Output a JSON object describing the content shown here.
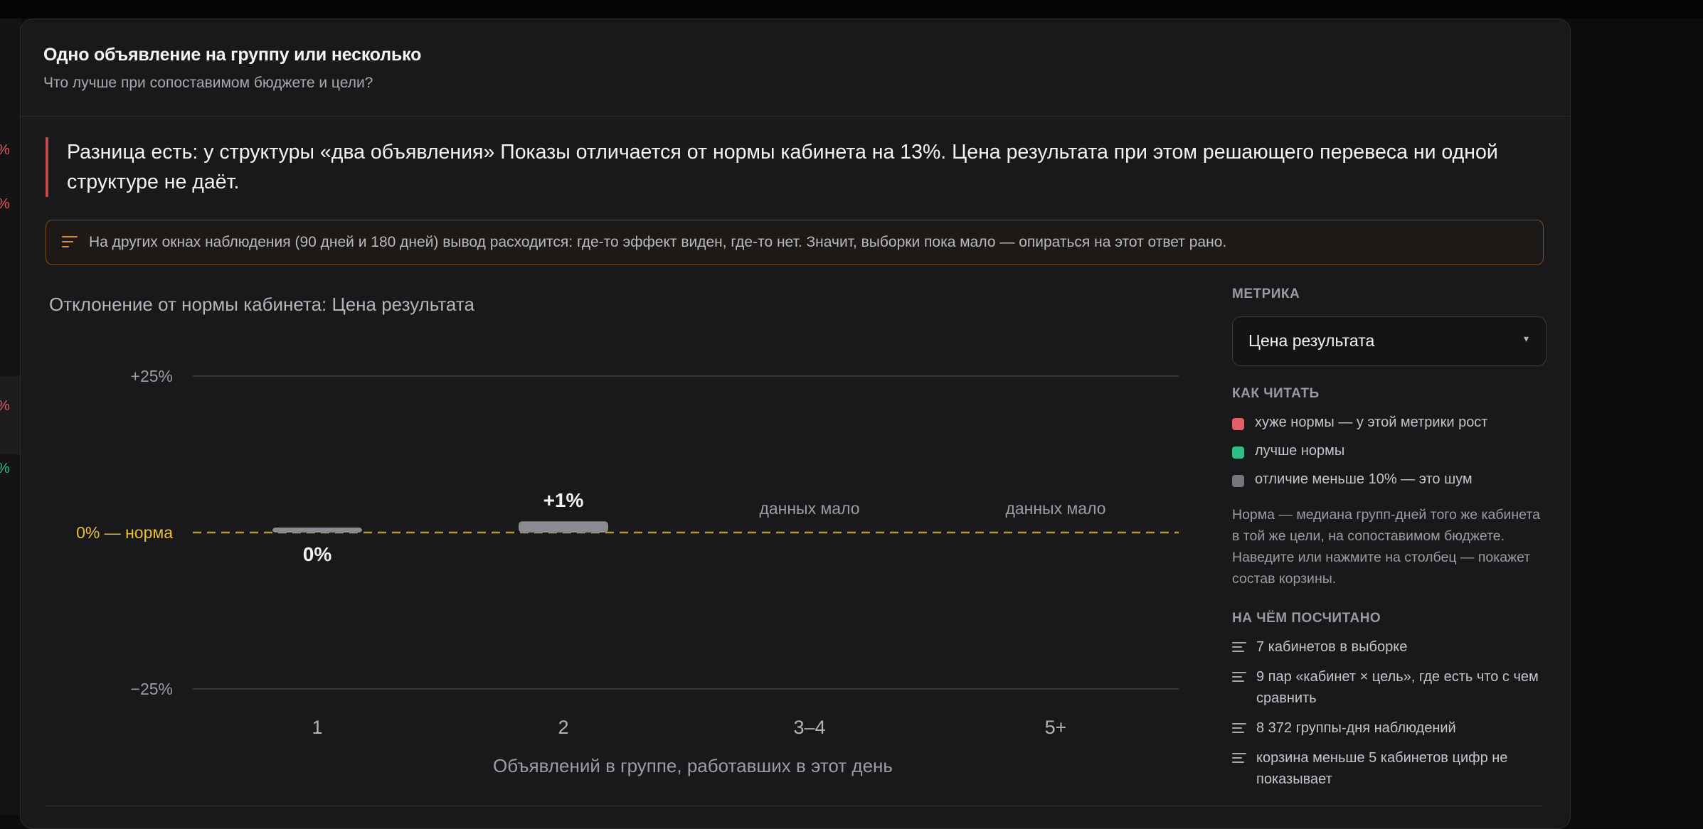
{
  "background_panel": {
    "percent_marks": [
      {
        "text": "%",
        "color": "#e05a5a"
      },
      {
        "text": "%",
        "color": "#e05a5a"
      },
      {
        "text": "%",
        "color": "#e05a5a"
      },
      {
        "text": "%",
        "color": "#2ebd85"
      }
    ]
  },
  "card": {
    "title": "Одно объявление на группу или несколько",
    "subtitle": "Что лучше при сопоставимом бюджете и цели?"
  },
  "verdict": {
    "text": "Разница есть: у структуры «два объявления» Показы отличается от нормы кабинета на 13%. Цена результата при этом решающего перевеса ни одной структуре не даёт.",
    "accent_color": "#c44a4a"
  },
  "notice": {
    "icon": "sort-lines-icon",
    "text": "На других окнах наблюдения (90 дней и 180 дней) вывод расходится: где-то эффект виден, где-то нет. Значит, выборки пока мало — опираться на этот ответ рано."
  },
  "chart": {
    "title": "Отклонение от нормы кабинета: Цена результата"
  },
  "chart_data": {
    "type": "bar",
    "title": "Отклонение от нормы кабинета: Цена результата",
    "xlabel": "Объявлений в группе, работавших в этот день",
    "ylabel": "",
    "ylim": [
      -25,
      25
    ],
    "yticks": [
      {
        "value": 25,
        "label": "+25%"
      },
      {
        "value": -25,
        "label": "−25%"
      }
    ],
    "reference_line": {
      "value": 0,
      "label": "0% — норма",
      "color": "#e8c033",
      "style": "dashed"
    },
    "categories": [
      "1",
      "2",
      "3–4",
      "5+"
    ],
    "values": [
      0,
      1,
      null,
      null
    ],
    "data_labels": [
      "0%",
      "+1%",
      "данных мало",
      "данных мало"
    ],
    "bar_color": "#8a8a90",
    "grid": true
  },
  "side": {
    "metric_label": "МЕТРИКА",
    "metric_value": "Цена результата",
    "caret": "▾",
    "how_to_read_label": "КАК ЧИТАТЬ",
    "legend": [
      {
        "color": "#e06068",
        "text": "хуже нормы — у этой метрики рост"
      },
      {
        "color": "#2ebd85",
        "text": "лучше нормы"
      },
      {
        "color": "#76767c",
        "text": "отличие меньше 10% — это шум"
      }
    ],
    "note": "Норма — медиана групп-дней того же кабинета в той же цели, на сопоставимом бюджете. Наведите или нажмите на столбец — покажет состав корзины.",
    "computed_label": "НА ЧЁМ ПОСЧИТАНО",
    "stats": [
      "7 кабинетов в выборке",
      "9 пар «кабинет × цель», где есть что с чем сравнить",
      "8 372 группы-дня наблюдений",
      "корзина меньше 5 кабинетов цифр не показывает"
    ]
  }
}
